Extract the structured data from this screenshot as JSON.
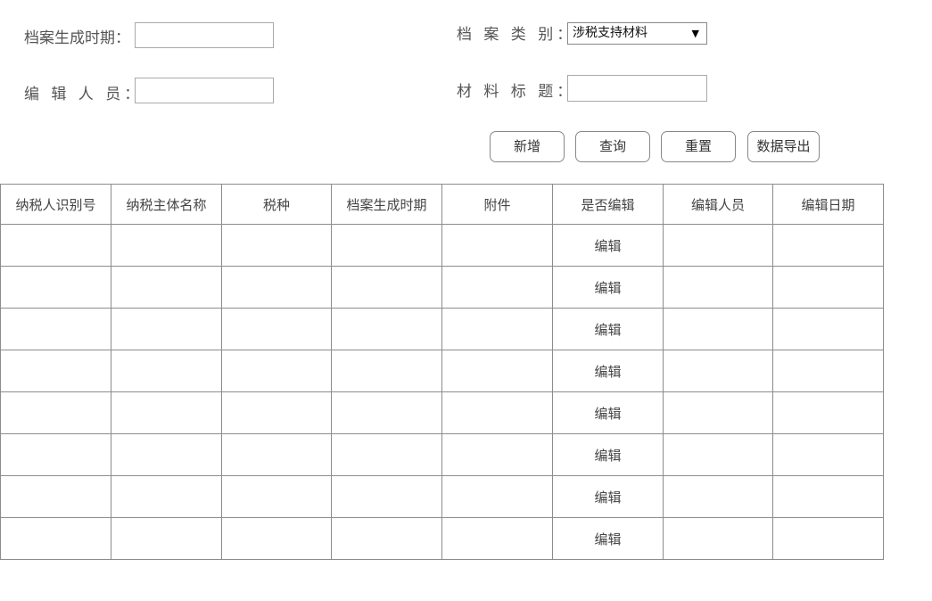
{
  "form": {
    "archive_date_label": "档案生成时期：",
    "archive_date_value": "",
    "archive_type_label": "档 案 类 别：",
    "archive_type_value": "涉税支持材料",
    "archive_type_arrow": "▼",
    "editor_label": "编 辑  人 员：",
    "editor_value": "",
    "material_title_label": "材 料 标 题：",
    "material_title_value": ""
  },
  "buttons": {
    "add": "新增",
    "query": "查询",
    "reset": "重置",
    "export": "数据导出"
  },
  "table": {
    "columns": [
      "纳税人识别号",
      "纳税主体名称",
      "税种",
      "档案生成时期",
      "附件",
      "是否编辑",
      "编辑人员",
      "编辑日期"
    ],
    "rows": [
      [
        "",
        "",
        "",
        "",
        "",
        "编辑",
        "",
        ""
      ],
      [
        "",
        "",
        "",
        "",
        "",
        "编辑",
        "",
        ""
      ],
      [
        "",
        "",
        "",
        "",
        "",
        "编辑",
        "",
        ""
      ],
      [
        "",
        "",
        "",
        "",
        "",
        "编辑",
        "",
        ""
      ],
      [
        "",
        "",
        "",
        "",
        "",
        "编辑",
        "",
        ""
      ],
      [
        "",
        "",
        "",
        "",
        "",
        "编辑",
        "",
        ""
      ],
      [
        "",
        "",
        "",
        "",
        "",
        "编辑",
        "",
        ""
      ],
      [
        "",
        "",
        "",
        "",
        "",
        "编辑",
        "",
        ""
      ]
    ]
  }
}
